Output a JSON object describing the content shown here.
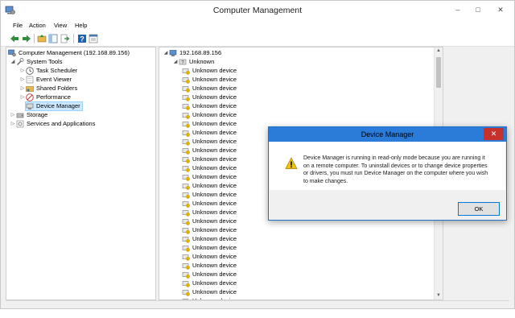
{
  "window": {
    "title": "Computer Management"
  },
  "menu": [
    "File",
    "Action",
    "View",
    "Help"
  ],
  "toolbar_icons": [
    "back-arrow-icon",
    "forward-arrow-icon",
    "up-folder-icon",
    "show-hide-tree-icon",
    "export-list-icon",
    "help-icon",
    "properties-icon"
  ],
  "tree": {
    "root": "Computer Management (192.168.89.156)",
    "system_tools": "System Tools",
    "children": [
      "Task Scheduler",
      "Event Viewer",
      "Shared Folders",
      "Performance",
      "Device Manager"
    ],
    "storage": "Storage",
    "services": "Services and Applications"
  },
  "devices": {
    "host": "192.168.89.156",
    "category": "Unknown",
    "item_label": "Unknown device"
  },
  "dialog": {
    "title": "Device Manager",
    "message": "Device Manager is running in read-only mode because you are running it on a remote computer. To uninstall devices or to change device properties or drivers, you must run Device Manager on the computer where you wish to make changes.",
    "ok_label": "OK"
  },
  "colors": {
    "accent": "#2b7bd8",
    "close": "#c8302b",
    "warning": "#f5c400"
  }
}
